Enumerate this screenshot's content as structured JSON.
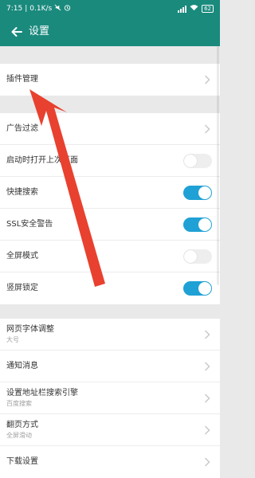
{
  "status_bar": {
    "time": "7:15",
    "separator": "|",
    "speed": "0.1K/s",
    "battery": "62"
  },
  "app_bar": {
    "title": "设置"
  },
  "settings": {
    "plugin_management": "插件管理",
    "ad_filter": "广告过滤",
    "open_last_page": "启动时打开上次页面",
    "quick_search": "快捷搜索",
    "ssl_warning": "SSL安全警告",
    "fullscreen_mode": "全屏模式",
    "portrait_lock": "竖屏锁定",
    "font_size_label": "网页字体调整",
    "font_size_value": "大号",
    "notifications": "通知消息",
    "address_bar_search_label": "设置地址栏搜索引擎",
    "address_bar_search_value": "百度搜索",
    "page_turn_label": "翻页方式",
    "page_turn_value": "全屏滑动",
    "download_settings": "下载设置"
  },
  "toggles": {
    "open_last_page": false,
    "quick_search": true,
    "ssl_warning": true,
    "fullscreen_mode": false,
    "portrait_lock": true
  },
  "colors": {
    "header": "#1a8a7d",
    "toggle_on": "#1fa1d5",
    "annotation_arrow": "#e8412f"
  },
  "icons": {
    "back": "arrow-left-icon",
    "chevron": "chevron-right-icon",
    "annotation": "red-annotation-arrow"
  }
}
